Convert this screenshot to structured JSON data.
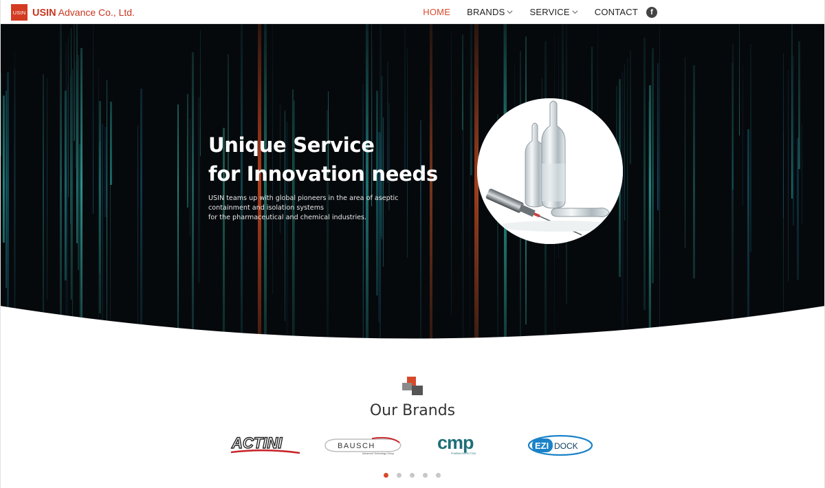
{
  "header": {
    "logo_box": "USIN",
    "logo_name": "USIN",
    "logo_sub": "Advance Co., Ltd.",
    "nav": [
      {
        "label": "HOME",
        "active": true
      },
      {
        "label": "BRANDS",
        "dropdown": true
      },
      {
        "label": "SERVICE",
        "dropdown": true
      },
      {
        "label": "CONTACT"
      }
    ],
    "social_icon": "facebook-icon",
    "social_glyph": "f"
  },
  "hero": {
    "title_line1": "Unique Service",
    "title_line2": "for Innovation needs",
    "desc_line1": "USIN teams up with global pioneers in the area of aseptic",
    "desc_line2": "containment and isolation systems",
    "desc_line3": "for the pharmaceutical and chemical industries."
  },
  "brands": {
    "title": "Our Brands",
    "items": [
      {
        "name": "ACTINI"
      },
      {
        "name": "BAUSCH",
        "tagline": "Advanced Technology Group"
      },
      {
        "name": "cmp",
        "tagline": "PHARMA INSPECTION"
      },
      {
        "name": "EZI",
        "name2": "DOCK"
      }
    ],
    "pagination": {
      "total": 5,
      "active": 0
    }
  },
  "colors": {
    "accent": "#d64a2b",
    "logo_red": "#d33b22",
    "hero_bg": "#06090c",
    "cmp_teal": "#1f6f78",
    "ezidock_blue": "#1a82c8"
  }
}
